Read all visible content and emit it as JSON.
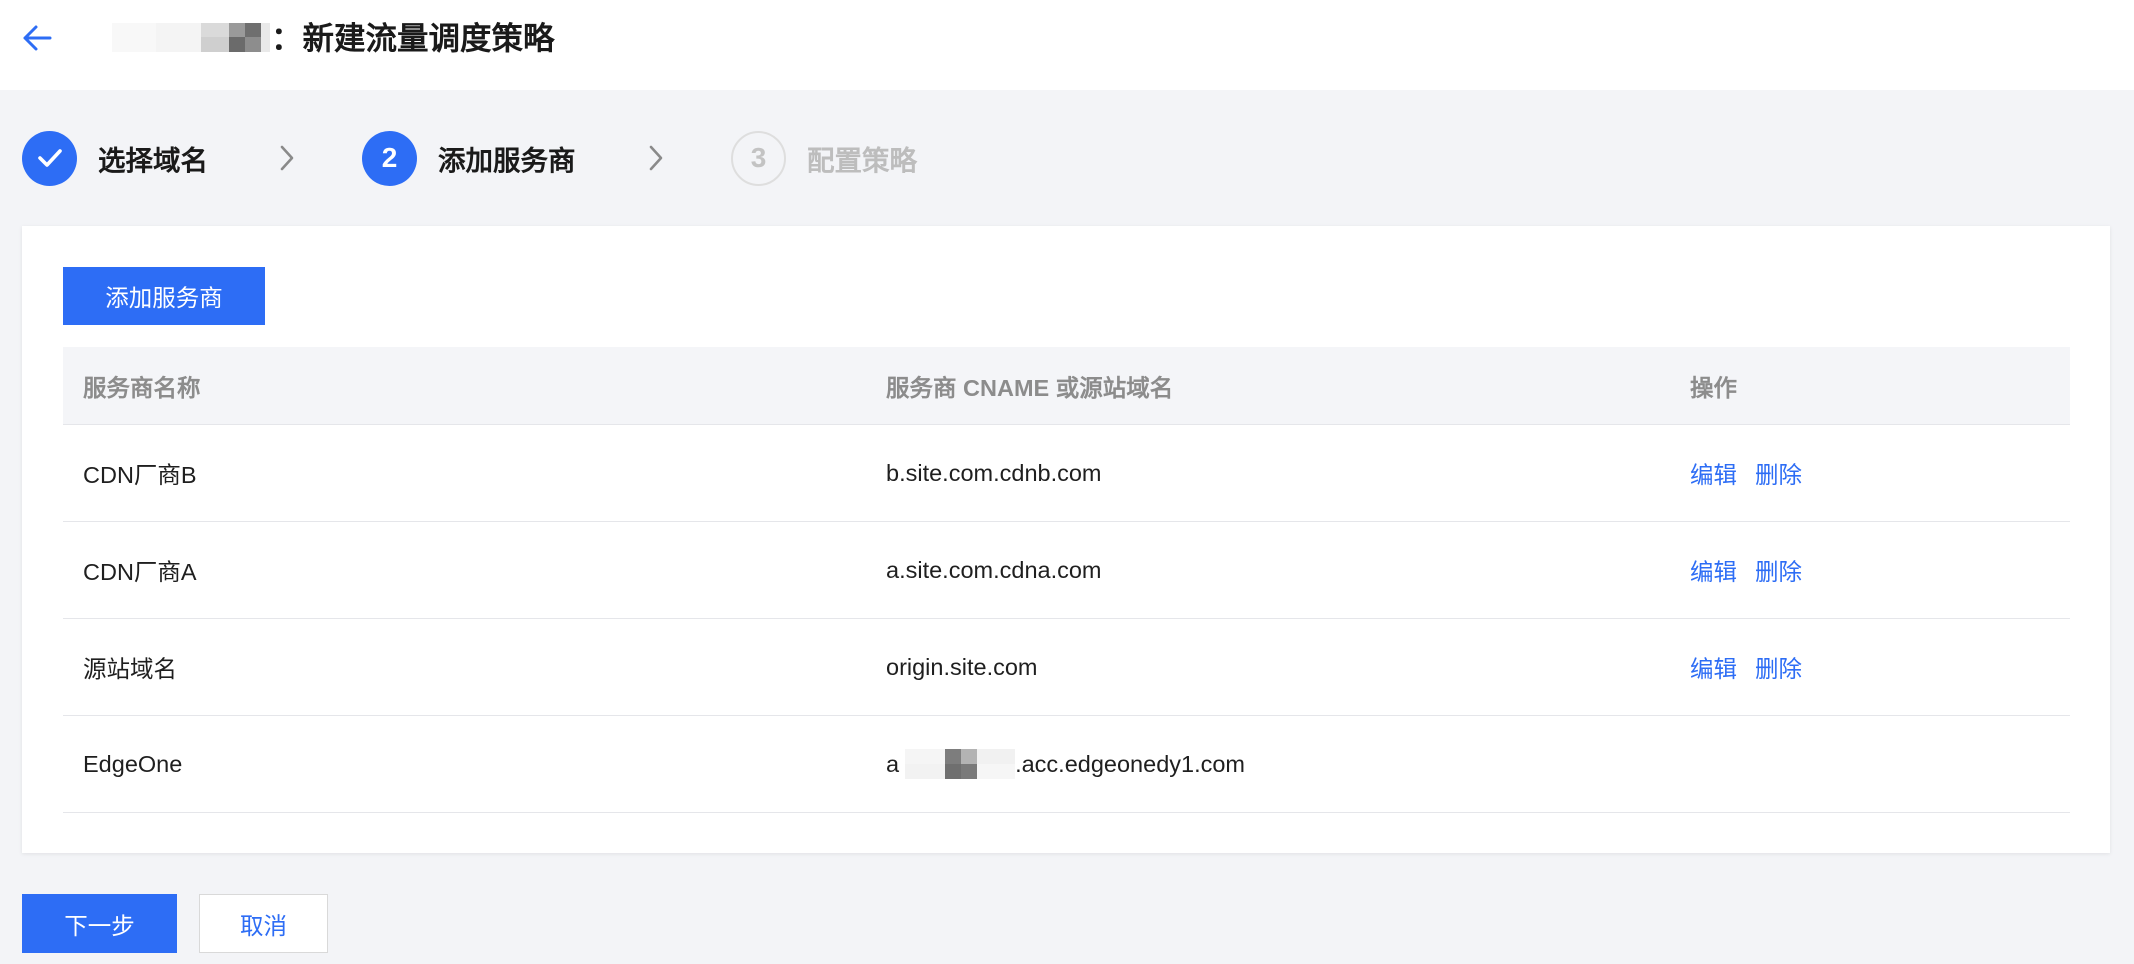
{
  "header": {
    "back_icon": "arrow-left-icon",
    "title": "：新建流量调度策略"
  },
  "steps": [
    {
      "icon": "check-icon",
      "label": "选择域名"
    },
    {
      "number": "2",
      "label": "添加服务商"
    },
    {
      "number": "3",
      "label": "配置策略"
    }
  ],
  "step_separator_icon": "chevron-right-icon",
  "card": {
    "add_button_label": "添加服务商",
    "table": {
      "columns": [
        "服务商名称",
        "服务商 CNAME 或源站域名",
        "操作"
      ],
      "rows": [
        {
          "name": "CDN厂商B",
          "domain": "b.site.com.cdnb.com",
          "actions": [
            "编辑",
            "删除"
          ]
        },
        {
          "name": "CDN厂商A",
          "domain": "a.site.com.cdna.com",
          "actions": [
            "编辑",
            "删除"
          ]
        },
        {
          "name": "源站域名",
          "domain": "origin.site.com",
          "actions": [
            "编辑",
            "删除"
          ]
        },
        {
          "name": "EdgeOne",
          "domain_prefix": "a",
          "domain_suffix": ".acc.edgeonedy1.com",
          "actions": []
        }
      ]
    }
  },
  "footer": {
    "next_label": "下一步",
    "cancel_label": "取消"
  },
  "colors": {
    "primary": "#2d6df5",
    "page_background": "#f3f4f7",
    "table_header_background": "#f4f5f8",
    "muted_text": "#8c8c8c",
    "disabled": "#bdbdbd"
  }
}
